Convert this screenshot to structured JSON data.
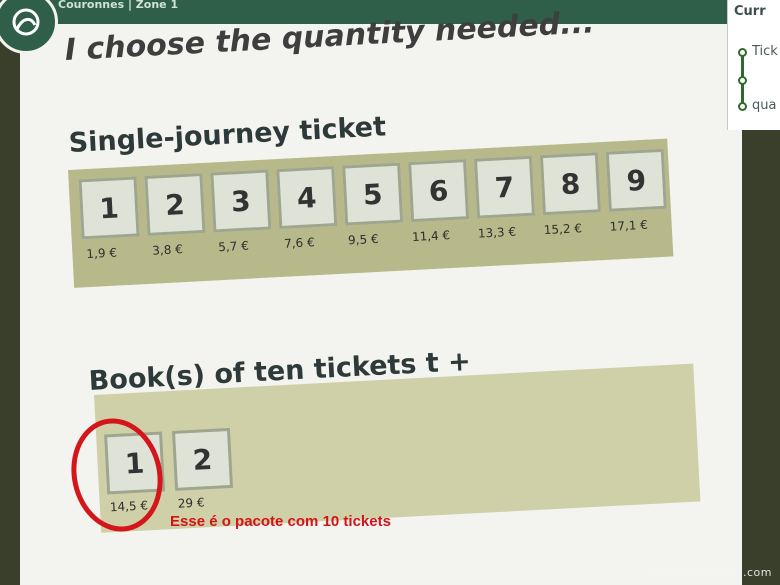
{
  "header": {
    "breadcrumb": "Couronnes | Zone 1"
  },
  "page_heading": "I choose the quantity needed...",
  "single_journey": {
    "title": "Single-journey ticket",
    "tickets": [
      {
        "qty": "1",
        "price": "1,9 €"
      },
      {
        "qty": "2",
        "price": "3,8 €"
      },
      {
        "qty": "3",
        "price": "5,7 €"
      },
      {
        "qty": "4",
        "price": "7,6 €"
      },
      {
        "qty": "5",
        "price": "9,5 €"
      },
      {
        "qty": "6",
        "price": "11,4 €"
      },
      {
        "qty": "7",
        "price": "13,3 €"
      },
      {
        "qty": "8",
        "price": "15,2 €"
      },
      {
        "qty": "9",
        "price": "17,1 €"
      }
    ]
  },
  "books": {
    "title": "Book(s) of ten tickets t +",
    "tickets": [
      {
        "qty": "1",
        "price": "14,5 €"
      },
      {
        "qty": "2",
        "price": "29 €"
      }
    ]
  },
  "annotation": "Esse é o pacote com 10 tickets",
  "side_panel": {
    "header": "Curr",
    "items": [
      "Tick",
      "qua"
    ]
  },
  "watermark": "guiamundoafora.com",
  "colors": {
    "brand_green": "#2f5e49",
    "band_single": "#b7b98a",
    "band_book": "#cfcfa8",
    "annotation_red": "#d41316"
  }
}
